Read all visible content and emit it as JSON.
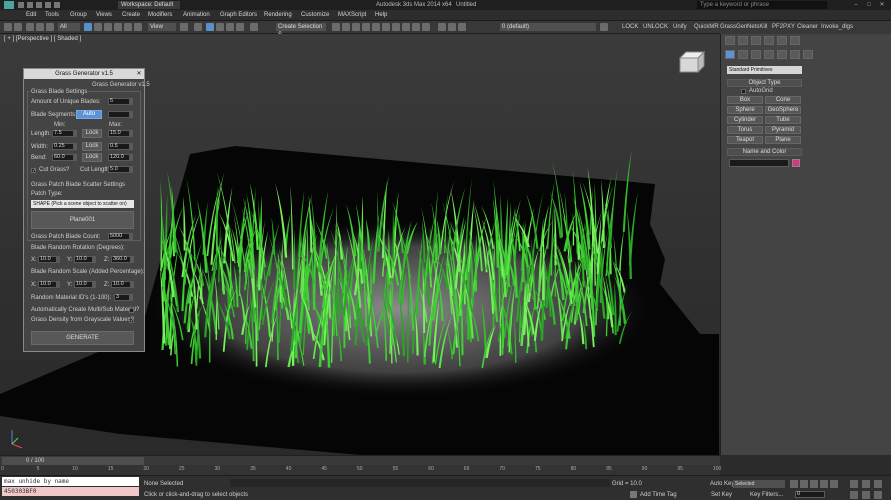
{
  "titlebar": {
    "workspace": "Workspace: Default",
    "app_title": "Autodesk 3ds Max 2014 x64",
    "doc_title": "Untitled",
    "search_placeholder": "Type a keyword or phrase"
  },
  "menu": [
    "Edit",
    "Tools",
    "Group",
    "Views",
    "Create",
    "Modifiers",
    "Animation",
    "Graph Editors",
    "Rendering",
    "Customize",
    "MAXScript",
    "Help"
  ],
  "toolbar": {
    "selection_filter": "All",
    "view": "View",
    "named_selection": "Create Selection S",
    "layer": "0 (default)",
    "right_items": [
      "LOCK",
      "UNLOCK",
      "Unify",
      "QuickMR",
      "GrassGen",
      "NetsKill",
      "PF2PXY",
      "Cleaner",
      "Invoke_dlgs"
    ]
  },
  "viewport": {
    "label": "[ + ] [Perspective ] [ Shaded ]"
  },
  "grass_dialog": {
    "title": "Grass Generator v1.5",
    "subtitle": "Grass Generator v1.5",
    "blade_settings": "Grass Blade Settings",
    "amount_label": "Amount of Unique Blades:",
    "amount_value": "5",
    "segments_label": "Blade Segments:",
    "segments_mode": "Auto",
    "min_label": "Min:",
    "max_label": "Max:",
    "length_label": "Length:",
    "length_min": "7.5",
    "length_max": "15.0",
    "width_label": "Width:",
    "width_min": "0.25",
    "width_max": "0.5",
    "bend_label": "Bend:",
    "bend_min": "60.0",
    "bend_max": "120.0",
    "lock_label": "Lock",
    "cut_grass_label": "Cut Grass?",
    "cut_length_label": "Cut Length:",
    "cut_length_value": "5.0",
    "scatter_settings": "Grass Patch Blade Scatter Settings",
    "patch_type_label": "Patch Type:",
    "patch_type_value": "SHAPE     (Pick a scene object to scatter on)",
    "picked_object": "Plane001",
    "blade_count_label": "Grass Patch Blade Count:",
    "blade_count_value": "5000",
    "rotation_label": "Blade Random Rotation (Degrees):",
    "rot_x": "10.0",
    "rot_y": "10.0",
    "rot_z": "360.0",
    "scale_label": "Blade Random Scale (Added Percentage):",
    "scale_x": "10.0",
    "scale_y": "10.0",
    "scale_z": "10.0",
    "x_label": "X:",
    "y_label": "Y:",
    "z_label": "Z:",
    "material_ids_label": "Random Material ID's (1-100):",
    "material_ids_value": "3",
    "multisub_label": "Automatically Create Multi/Sub Material?",
    "density_label": "Grass Density from Grayscale Values?",
    "generate_label": "GENERATE"
  },
  "command_panel": {
    "category": "Standard Primitives",
    "object_type_header": "Object Type",
    "autogrid": "AutoGrid",
    "primitives": [
      "Box",
      "Cone",
      "Sphere",
      "GeoSphere",
      "Cylinder",
      "Tube",
      "Torus",
      "Pyramid",
      "Teapot",
      "Plane"
    ],
    "name_color_header": "Name and Color",
    "object_color": "#d9357a"
  },
  "timeline": {
    "frame": "0 / 100",
    "ticks": [
      "0",
      "5",
      "10",
      "15",
      "20",
      "25",
      "30",
      "35",
      "40",
      "45",
      "50",
      "55",
      "60",
      "65",
      "70",
      "75",
      "80",
      "85",
      "90",
      "95",
      "100"
    ]
  },
  "status": {
    "selection": "None Selected",
    "prompt": "Click or click-and-drag to select objects",
    "grid": "Grid = 10.0",
    "add_time_tag": "Add Time Tag",
    "auto_key": "Auto Key",
    "set_key": "Set Key",
    "key_mode": "Selected",
    "key_filters": "Key Filters...",
    "frame_value": "0"
  },
  "maxscript": {
    "line1": "max unhide by name",
    "line2": "450303BF0"
  }
}
